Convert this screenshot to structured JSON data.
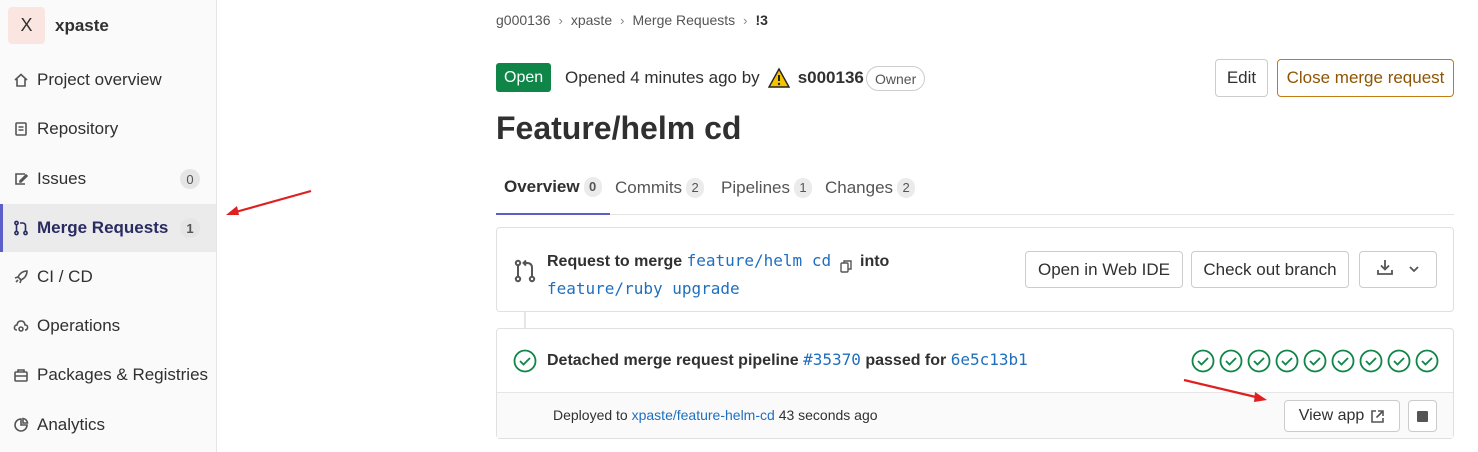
{
  "sidebar": {
    "project_initial": "X",
    "project_name": "xpaste",
    "items": [
      {
        "label": "Project overview",
        "icon": "home-icon"
      },
      {
        "label": "Repository",
        "icon": "document-icon"
      },
      {
        "label": "Issues",
        "icon": "issues-icon",
        "count": "0"
      },
      {
        "label": "Merge Requests",
        "icon": "merge-request-icon",
        "count": "1",
        "active": true
      },
      {
        "label": "CI / CD",
        "icon": "rocket-icon"
      },
      {
        "label": "Operations",
        "icon": "cloud-gear-icon"
      },
      {
        "label": "Packages & Registries",
        "icon": "package-icon"
      },
      {
        "label": "Analytics",
        "icon": "chart-icon"
      }
    ]
  },
  "breadcrumb": [
    "g000136",
    "xpaste",
    "Merge Requests",
    "!3"
  ],
  "header": {
    "status": "Open",
    "opened_text": "Opened 4 minutes ago by",
    "author": "s000136",
    "author_role": "Owner",
    "edit_label": "Edit",
    "close_label": "Close merge request"
  },
  "title": "Feature/helm cd",
  "tabs": [
    {
      "label": "Overview",
      "count": "0",
      "active": true
    },
    {
      "label": "Commits",
      "count": "2"
    },
    {
      "label": "Pipelines",
      "count": "1"
    },
    {
      "label": "Changes",
      "count": "2"
    }
  ],
  "merge_widget": {
    "prefix": "Request to merge",
    "source_branch": "feature/helm cd",
    "into": "into",
    "target_branch": "feature/ruby upgrade",
    "web_ide_label": "Open in Web IDE",
    "checkout_label": "Check out branch"
  },
  "pipeline": {
    "prefix": "Detached merge request pipeline",
    "pipeline_id": "#35370",
    "passed_for": "passed for",
    "commit": "6e5c13b1",
    "stage_count": 9,
    "status_color": "#108548"
  },
  "deployment": {
    "prefix": "Deployed to",
    "environment": "xpaste/feature-helm-cd",
    "time": "43 seconds ago",
    "view_app_label": "View app"
  },
  "colors": {
    "accent": "#5b5fc7",
    "open_badge": "#108548",
    "link": "#1f6fbf",
    "close_button": "#c17d10",
    "annotation_arrow": "#e02020"
  }
}
